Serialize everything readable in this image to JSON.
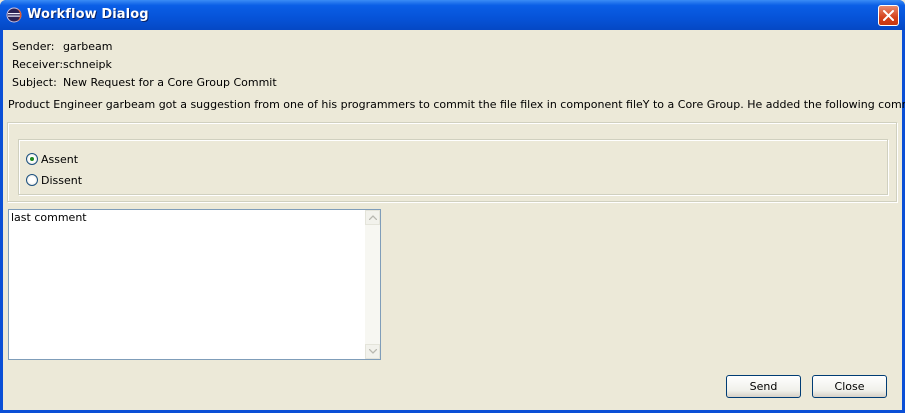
{
  "window": {
    "title": "Workflow Dialog",
    "app_icon": "eclipse-icon",
    "close_icon": "close-icon"
  },
  "header": {
    "sender_label": "Sender:",
    "sender_value": "garbeam",
    "receiver_label": "Receiver:",
    "receiver_value": "schneipk",
    "subject_label": "Subject:",
    "subject_value": "New Request for a Core Group Commit"
  },
  "description": "Product Engineer garbeam got a suggestion from one of his programmers to commit the file filex in component fileY to a Core Group. He added the following comment: another comment",
  "decision": {
    "options": [
      {
        "label": "Assent",
        "selected": true
      },
      {
        "label": "Dissent",
        "selected": false
      }
    ]
  },
  "comment": {
    "value": "last comment"
  },
  "buttons": {
    "send_label": "Send",
    "close_label": "Close"
  },
  "colors": {
    "titlebar": "#0653d8",
    "dialog_bg": "#ece9d8",
    "close_button": "#d5421c"
  }
}
